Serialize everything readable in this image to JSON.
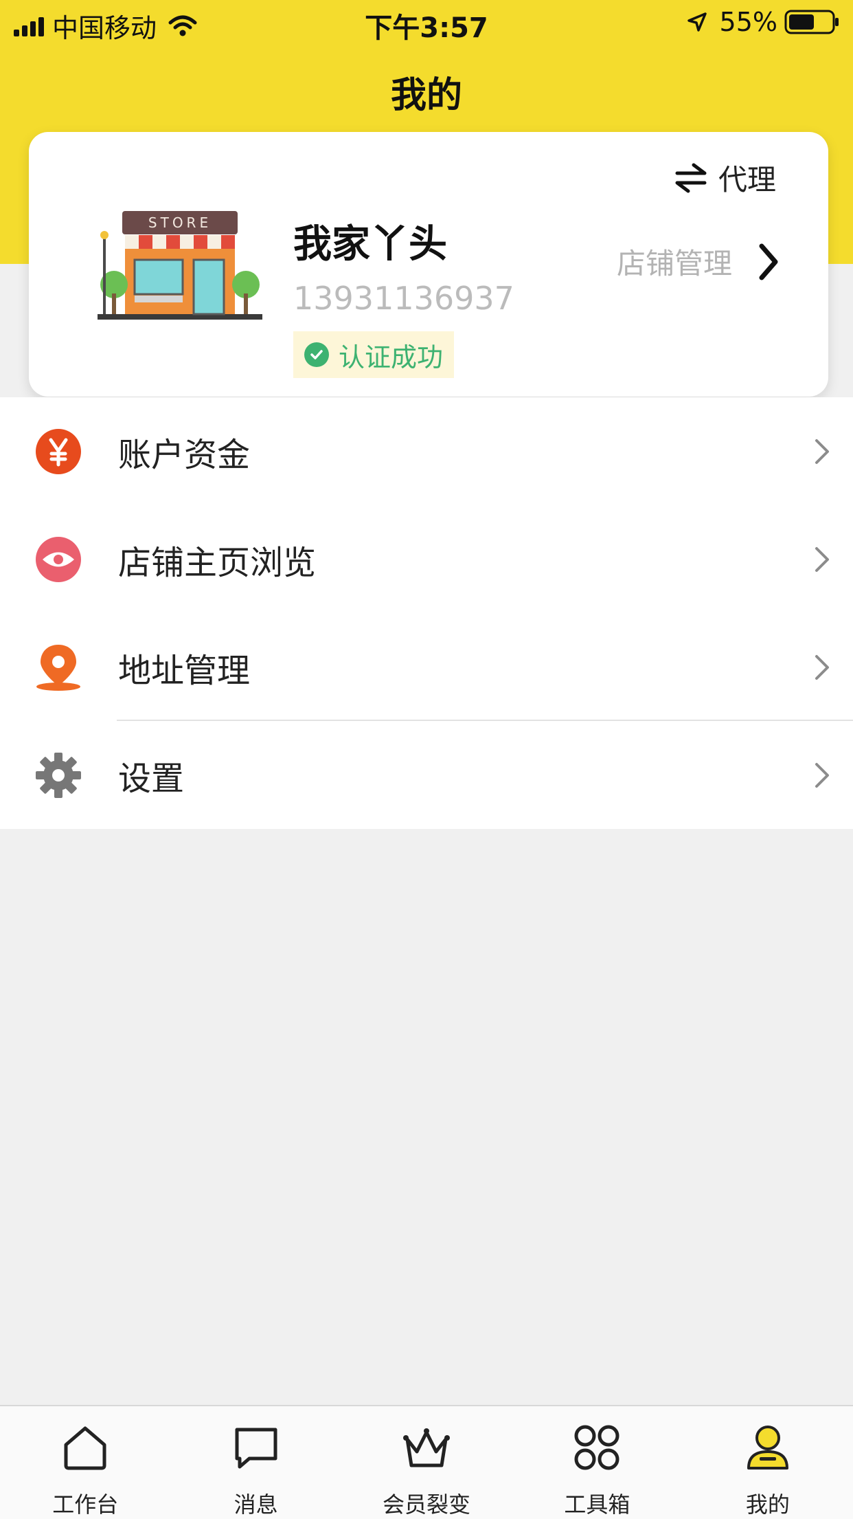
{
  "status_bar": {
    "carrier": "中国移动",
    "time": "下午3:57",
    "battery": "55%"
  },
  "nav": {
    "title": "我的"
  },
  "profile": {
    "agent_label": "代理",
    "shop_name": "我家丫头",
    "phone": "13931136937",
    "verified_label": "认证成功",
    "store_manage_label": "店铺管理",
    "store_sign": "STORE"
  },
  "menu": {
    "items": [
      {
        "label": "账户资金",
        "icon": "yen-icon",
        "color": "#e74b1d"
      },
      {
        "label": "店铺主页浏览",
        "icon": "eye-icon",
        "color": "#ea5f6e"
      },
      {
        "label": "地址管理",
        "icon": "location-pin-icon",
        "color": "#ef6a24"
      },
      {
        "label": "设置",
        "icon": "gear-icon",
        "color": "#777777"
      }
    ]
  },
  "tabbar": {
    "items": [
      {
        "label": "工作台",
        "icon": "home-icon"
      },
      {
        "label": "消息",
        "icon": "message-icon"
      },
      {
        "label": "会员裂变",
        "icon": "crown-icon"
      },
      {
        "label": "工具箱",
        "icon": "toolbox-icon"
      },
      {
        "label": "我的",
        "icon": "user-icon",
        "active": true
      }
    ]
  },
  "colors": {
    "brand_yellow": "#f4dc2d",
    "success_green": "#3db271",
    "page_bg": "#f0f0f0"
  }
}
